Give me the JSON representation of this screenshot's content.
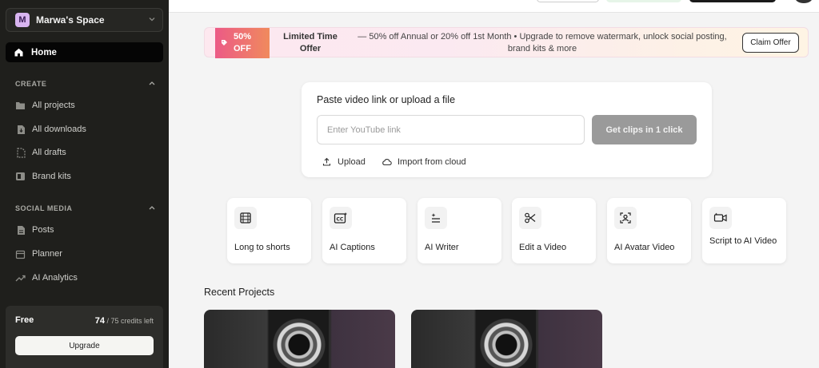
{
  "sidebar": {
    "workspace": {
      "initial": "M",
      "name": "Marwa's Space"
    },
    "home_label": "Home",
    "create": {
      "title": "CREATE",
      "items": [
        {
          "label": "All projects",
          "icon": "folder-icon"
        },
        {
          "label": "All downloads",
          "icon": "download-file-icon"
        },
        {
          "label": "All drafts",
          "icon": "draft-icon"
        },
        {
          "label": "Brand kits",
          "icon": "brand-kit-icon"
        }
      ]
    },
    "social": {
      "title": "SOCIAL MEDIA",
      "items": [
        {
          "label": "Posts",
          "icon": "posts-icon"
        },
        {
          "label": "Planner",
          "icon": "calendar-icon"
        },
        {
          "label": "AI Analytics",
          "icon": "trend-icon"
        }
      ]
    },
    "plan": {
      "name": "Free",
      "credits_used": "74",
      "credits_suffix": "/ 75 credits left",
      "upgrade_label": "Upgrade"
    }
  },
  "promo": {
    "badge_line1": "50%",
    "badge_line2": "OFF",
    "title": "Limited Time Offer",
    "text": "— 50% off Annual or 20% off 1st Month • Upgrade to remove watermark, unlock social posting, brand kits & more",
    "claim_label": "Claim Offer"
  },
  "upload": {
    "title": "Paste video link or upload a file",
    "placeholder": "Enter YouTube link",
    "cta_label": "Get clips in 1 click",
    "upload_label": "Upload",
    "cloud_label": "Import from cloud"
  },
  "tools": [
    {
      "label": "Long to shorts",
      "icon": "film-icon"
    },
    {
      "label": "AI Captions",
      "icon": "captions-icon"
    },
    {
      "label": "AI Writer",
      "icon": "writer-icon"
    },
    {
      "label": "Edit a Video",
      "icon": "scissors-icon"
    },
    {
      "label": "AI Avatar Video",
      "icon": "avatar-icon"
    },
    {
      "label": "Script to AI Video",
      "icon": "video-camera-icon"
    }
  ],
  "recent": {
    "title": "Recent Projects"
  },
  "colors": {
    "sidebar_bg": "#1f1f1c",
    "accent_pink": "#ec5a86",
    "accent_orange": "#f08a5d",
    "cta_disabled": "#9a9a9a"
  }
}
